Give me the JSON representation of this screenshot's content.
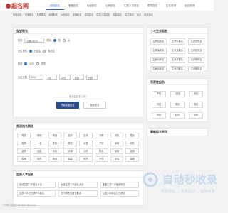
{
  "site": {
    "logo": "起名网"
  },
  "nav": [
    "在线起名",
    "宝宝起名",
    "免费起名",
    "公司起名",
    "生辰八字起名",
    "周易起名",
    "吉名查询",
    "起名知识"
  ],
  "subnav": [
    "宝宝起名",
    "宝宝取名",
    "男孩取名",
    "女孩取名",
    "公司起名",
    "店铺起名",
    "诗词起名",
    "生辰八字起名",
    "周易起名",
    "名字测试",
    "改名",
    "英文起名"
  ],
  "form": {
    "title": "宝宝取名",
    "surname_label": "姓氏",
    "surname_placeholder": "请输入姓氏",
    "gender_label": "性别",
    "gender_male": "男",
    "gender_female": "女",
    "state_label": "出生状态",
    "state_born": "已出生",
    "state_unborn": "未出生",
    "calendar_label": "历法",
    "calendar_solar": "公历",
    "calendar_lunar": "农历",
    "date_label": "出生日期",
    "year": "2024",
    "month": "6月",
    "day": "15日",
    "hour": "时辰",
    "minute": "分钟",
    "hint": "免费起名字(公历)",
    "submit": "开始智能起名",
    "secondary": "免费查名"
  },
  "right1": {
    "title": "十二生肖起名",
    "items": [
      "生肖鼠取名",
      "生肖牛取名",
      "生肖虎取名",
      "生肖兔取名",
      "生肖龙取名",
      "生肖蛇取名",
      "生肖马取名",
      "生肖羊取名",
      "生肖猴取名",
      "生肖鸡取名",
      "生肖狗取名",
      "生肖猪取名"
    ]
  },
  "right2": {
    "title": "百家姓起名",
    "items": [
      "李姓",
      "王姓",
      "张姓",
      "刘姓",
      "陈姓",
      "杨姓",
      "黄姓",
      "赵姓",
      "吴姓"
    ]
  },
  "right3": {
    "title": "最新起名资讯"
  },
  "names": {
    "title": "男孩热名精选",
    "items": [
      "奕辰",
      "皓轩",
      "梓涵",
      "浩宇",
      "铭泽",
      "子墨",
      "宇航",
      "思远",
      "俊熙",
      "一诺",
      "沐阳",
      "博文",
      "睿哲",
      "子轩",
      "晨曦",
      "明轩",
      "浩然",
      "嘉懿",
      "天佑",
      "宇泽",
      "钰轩",
      "梓睿",
      "瑾瑜",
      "煜祺",
      "俊楠",
      "昊然",
      "致远",
      "瑞霖",
      "修杰",
      "子骞",
      "凯瑞",
      "锦程"
    ]
  },
  "bazi": {
    "title": "生辰八字起名",
    "items": [
      "男孩生辰八字起名大全",
      "女孩生辰八字起名大全",
      "宝宝生辰八字免费取名",
      "生辰八字五行缺什么起名",
      "五行缺木的宝宝取名",
      "生辰八字起名打分测试"
    ]
  },
  "footer": "© 2024 起名网 All Rights Reserved",
  "watermark": {
    "main": "自动秒收录",
    "sub": "收录网站 → 免费提交 → 自动收录"
  }
}
